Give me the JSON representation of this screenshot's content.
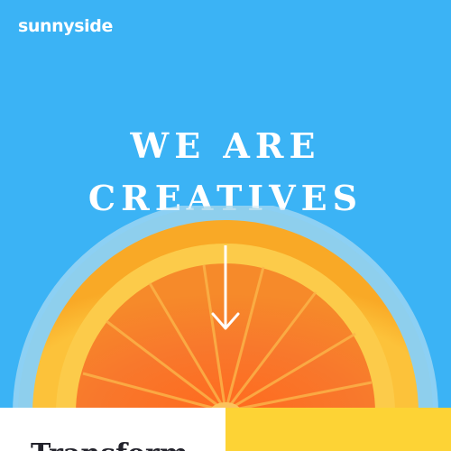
{
  "header": {
    "logo_text": "sunnyside"
  },
  "hero": {
    "title_line1": "WE ARE",
    "title_line2": "CREATIVES",
    "image": "orange-slice-in-glass",
    "arrow_icon": "arrow-down-icon"
  },
  "sections": {
    "transform": {
      "heading": "Transform"
    }
  },
  "colors": {
    "hero_background": "#3bb3f5",
    "text_light": "#ffffff",
    "text_dark": "#22222b",
    "accent_yellow": "#fdd335",
    "orange": "#f7762b",
    "rind": "#fbb430"
  }
}
